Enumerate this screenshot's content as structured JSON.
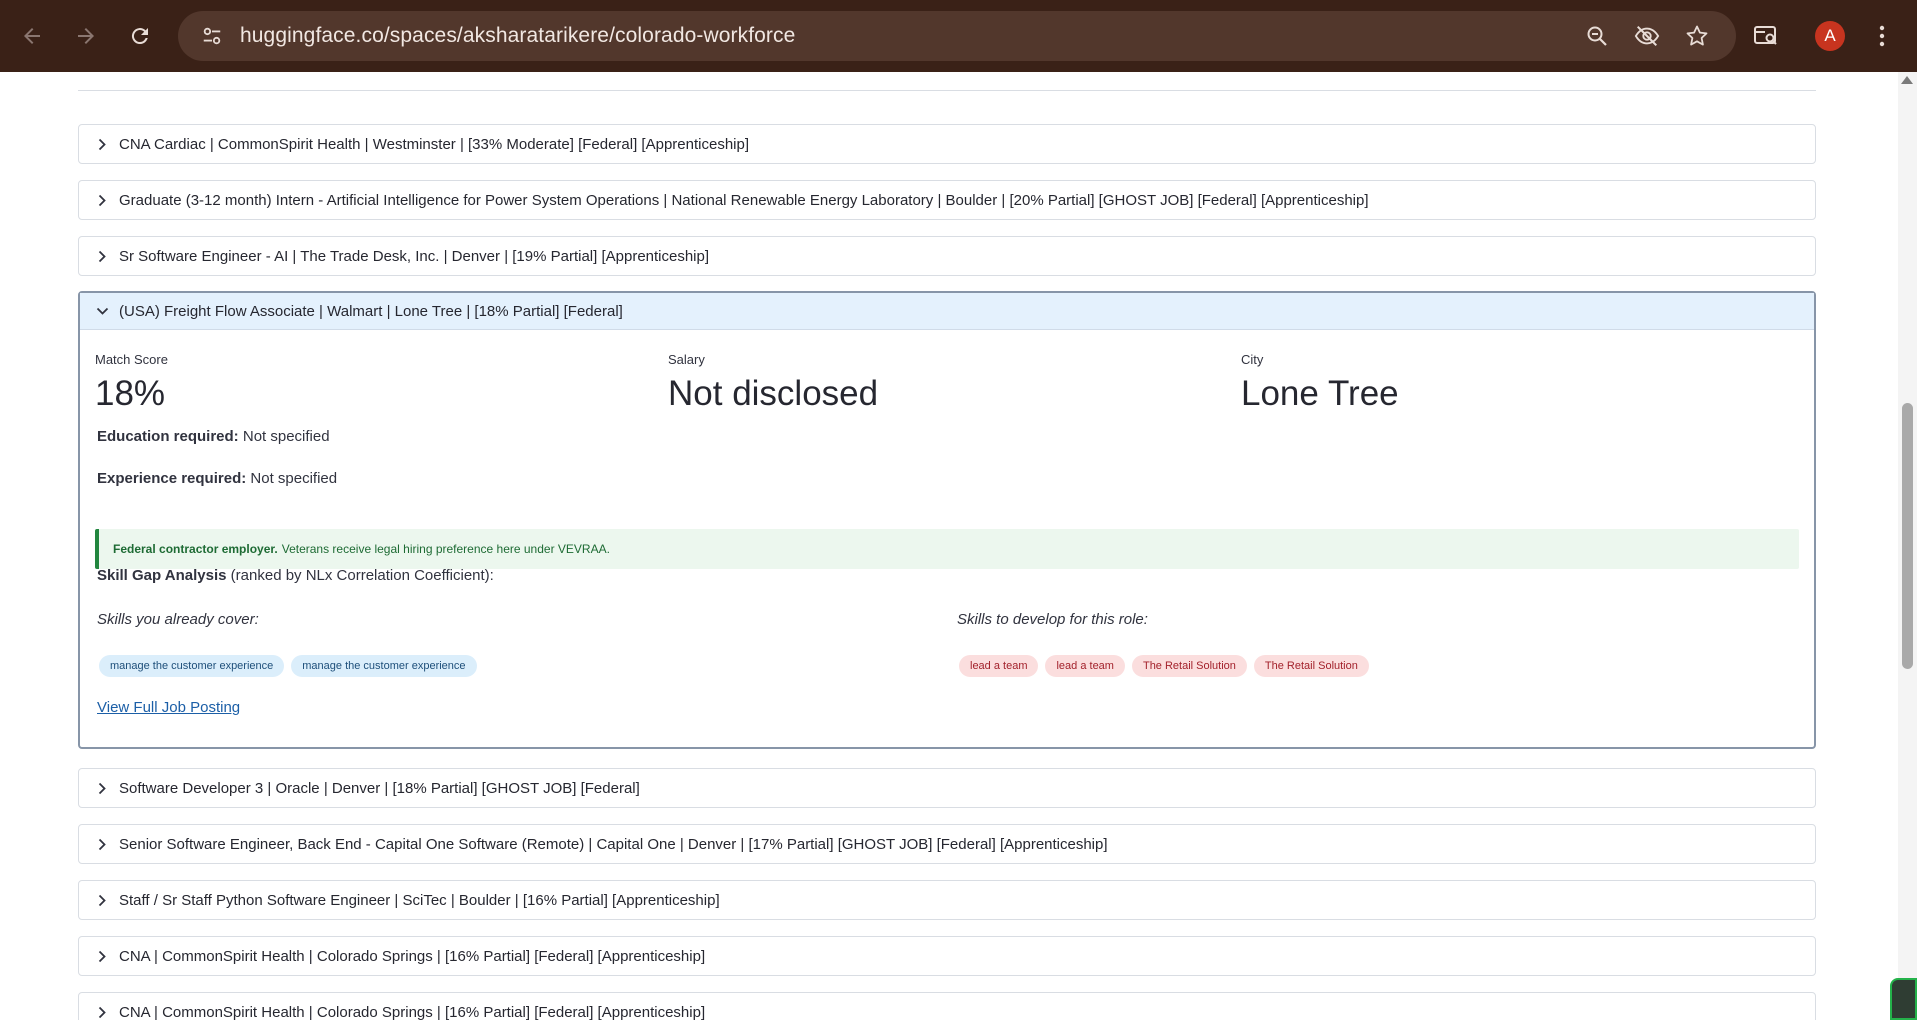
{
  "browser": {
    "url": "huggingface.co/spaces/aksharatarikere/colorado-workforce",
    "profile_initial": "A",
    "icons": [
      "back-arrow-icon",
      "forward-arrow-icon",
      "reload-icon",
      "site-info-icon",
      "zoom-icon",
      "tracking-protection-eye-slash-icon",
      "bookmark-star-icon",
      "tab-search-icon",
      "kebab-menu-icon"
    ]
  },
  "jobs": [
    {
      "title": "CNA Cardiac | CommonSpirit Health | Westminster | [33% Moderate] [Federal] [Apprenticeship]",
      "expanded": false
    },
    {
      "title": "Graduate (3-12 month) Intern - Artificial Intelligence for Power System Operations | National Renewable Energy Laboratory | Boulder | [20% Partial] [GHOST JOB] [Federal] [Apprenticeship]",
      "expanded": false
    },
    {
      "title": "Sr Software Engineer - AI | The Trade Desk, Inc. | Denver | [19% Partial] [Apprenticeship]",
      "expanded": false
    },
    {
      "title": "(USA) Freight Flow Associate | Walmart | Lone Tree | [18% Partial] [Federal]",
      "expanded": true
    },
    {
      "title": "Software Developer 3 | Oracle | Denver | [18% Partial] [GHOST JOB] [Federal]",
      "expanded": false
    },
    {
      "title": "Senior Software Engineer, Back End - Capital One Software (Remote) | Capital One | Denver | [17% Partial] [GHOST JOB] [Federal] [Apprenticeship]",
      "expanded": false
    },
    {
      "title": "Staff / Sr Staff Python Software Engineer | SciTec | Boulder | [16% Partial] [Apprenticeship]",
      "expanded": false
    },
    {
      "title": "CNA | CommonSpirit Health | Colorado Springs | [16% Partial] [Federal] [Apprenticeship]",
      "expanded": false
    },
    {
      "title": "CNA | CommonSpirit Health | Colorado Springs | [16% Partial] [Federal] [Apprenticeship]",
      "expanded": false
    }
  ],
  "detail": {
    "metrics": [
      {
        "label": "Match Score",
        "value": "18%"
      },
      {
        "label": "Salary",
        "value": "Not disclosed"
      },
      {
        "label": "City",
        "value": "Lone Tree"
      }
    ],
    "education_label": "Education required:",
    "education_value": "Not specified",
    "experience_label": "Experience required:",
    "experience_value": "Not specified",
    "alert_bold": "Federal contractor employer.",
    "alert_text": "Veterans receive legal hiring preference here under VEVRAA.",
    "skill_gap_bold": "Skill Gap Analysis",
    "skill_gap_rest": "(ranked by NLx Correlation Coefficient):",
    "covered_heading": "Skills you already cover:",
    "develop_heading": "Skills to develop for this role:",
    "covered_skills": [
      "manage the customer experience",
      "manage the customer experience"
    ],
    "develop_skills": [
      "lead a team",
      "lead a team",
      "The Retail Solution",
      "The Retail Solution"
    ],
    "link_text": "View Full Job Posting"
  },
  "colors": {
    "chrome_bg": "#3a2117",
    "omnibox_bg": "#52372c",
    "expanded_header_bg": "#e4f1fd",
    "alert_bg": "#ecf7ee",
    "alert_border": "#21863e",
    "chip_blue": "#dbeefb",
    "chip_red": "#fbdede",
    "link": "#1c5fa7"
  }
}
